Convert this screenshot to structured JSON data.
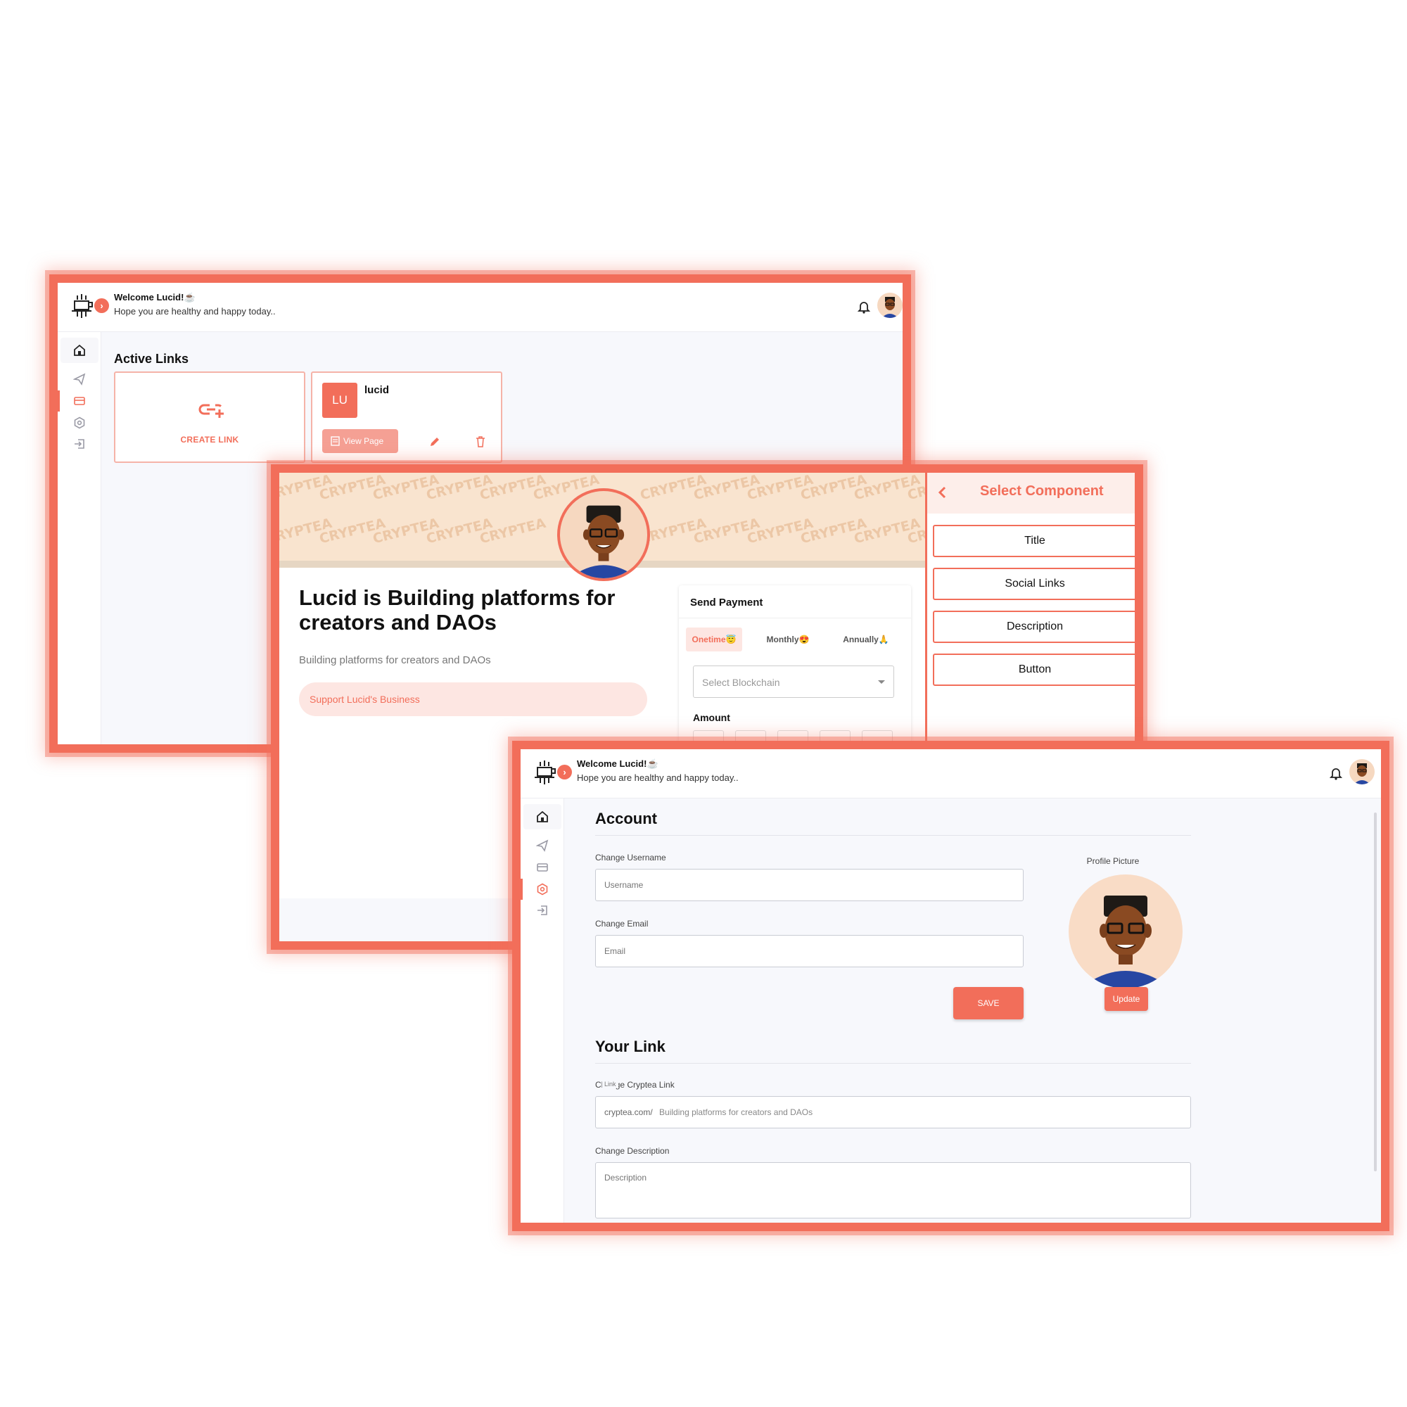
{
  "colors": {
    "accent": "#f26e5a",
    "accent_soft": "#fde6e2",
    "background": "#f7f8fc"
  },
  "dashboard": {
    "welcome": "Welcome Lucid!☕",
    "subtitle": "Hope you are healthy and happy today..",
    "section_title": "Active Links",
    "create_link_label": "CREATE LINK",
    "link_card": {
      "initials": "LU",
      "name": "lucid",
      "view_button": "View Page"
    },
    "sidebar_icons": [
      "home-icon",
      "send-icon",
      "card-icon",
      "settings-icon",
      "logout-icon"
    ]
  },
  "link_page": {
    "watermark": "CRYPTEA",
    "title": "Lucid is Building platforms for creators and DAOs",
    "description": "Building platforms for creators and DAOs",
    "support_button": "Support Lucid's Business",
    "payment": {
      "title": "Send Payment",
      "tabs": [
        "Onetime😇",
        "Monthly😍",
        "Annually🙏"
      ],
      "active_tab": "Onetime😇",
      "select_placeholder": "Select Blockchain",
      "amount_label": "Amount"
    },
    "component_panel": {
      "title": "Select Component",
      "options": [
        "Title",
        "Social Links",
        "Description",
        "Button"
      ]
    }
  },
  "settings": {
    "welcome": "Welcome Lucid!☕",
    "subtitle": "Hope you are healthy and happy today..",
    "account_title": "Account",
    "username_label": "Change Username",
    "username_placeholder": "Username",
    "email_label": "Change Email",
    "email_placeholder": "Email",
    "save_button": "SAVE",
    "profile_picture_label": "Profile Picture",
    "update_button": "Update",
    "your_link_title": "Your Link",
    "link_label": "Change Cryptea Link",
    "link_legend": "Link",
    "link_prefix": "cryptea.com/",
    "link_value": "Building platforms for creators and DAOs",
    "description_label": "Change Description",
    "description_placeholder": "Description"
  }
}
